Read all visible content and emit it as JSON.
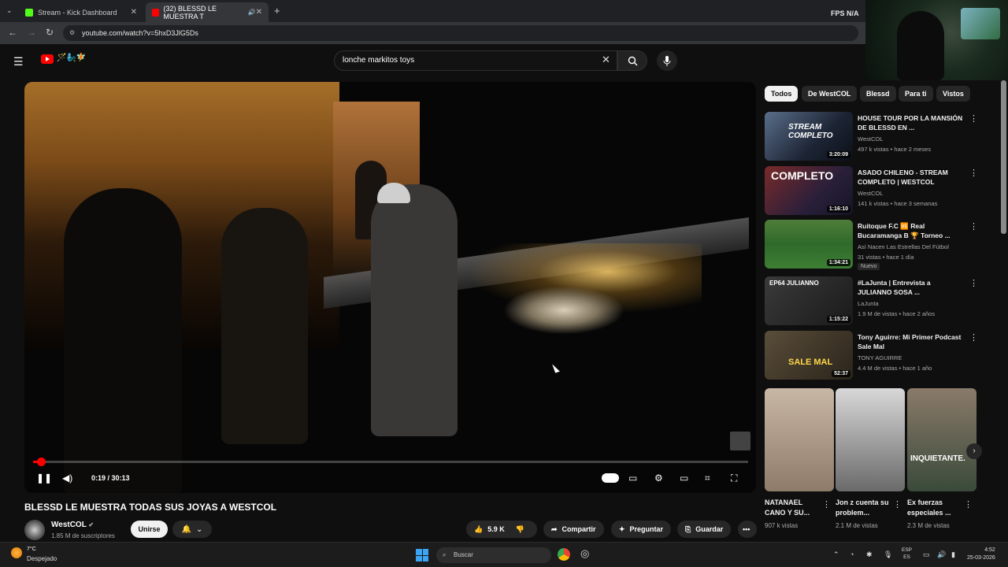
{
  "browser": {
    "tabs": [
      {
        "label": "Stream - Kick Dashboard",
        "active": false
      },
      {
        "label": "(32) BLESSD LE MUESTRA T",
        "active": true
      }
    ],
    "new_tab": "+",
    "url": "youtube.com/watch?v=5hxD3JlG5Ds",
    "fps_label": "FPS",
    "fps_value": "N/A"
  },
  "youtube": {
    "search_query": "lonche markitos toys",
    "logo_emoji": "🪄🧞‍♂️🧚"
  },
  "player": {
    "time": "0:19 / 30:13",
    "progress_fraction": 0.0105
  },
  "video": {
    "title": "BLESSD LE MUESTRA TODAS SUS JOYAS A WESTCOL",
    "channel": "WestCOL",
    "subscribers": "1.85 M de suscriptores",
    "join_label": "Unirse",
    "likes": "5.9 K",
    "share_label": "Compartir",
    "ask_label": "Preguntar",
    "save_label": "Guardar"
  },
  "chips": [
    "Todos",
    "De WestCOL",
    "Blessd",
    "Para ti",
    "Vistos"
  ],
  "recommendations": [
    {
      "title": "HOUSE TOUR POR LA MANSIÓN DE BLESSD EN ...",
      "channel": "WestCOL",
      "meta": "497 k vistas • hace 2 meses",
      "duration": "3:20:09"
    },
    {
      "title": "ASADO CHILENO - STREAM COMPLETO | WESTCOL",
      "channel": "WestCOL",
      "meta": "141 k vistas • hace 3 semanas",
      "duration": "1:16:10"
    },
    {
      "title": "Ruitoque F.C 🆚 Real Bucaramanga B 🏆 Torneo ...",
      "channel": "Así Nacen Las Estrellas Del Fútbol",
      "meta": "31 vistas • hace 1 día",
      "duration": "1:34:21",
      "badge": "Nuevo"
    },
    {
      "title": "#LaJunta | Entrevista a JULIANNO SOSA ...",
      "channel": "LaJunta",
      "meta": "1.9 M de vistas • hace 2 años",
      "duration": "1:15:22"
    },
    {
      "title": "Tony Aguirre: Mi Primer Podcast Sale Mal",
      "channel": "TONY AGUIRRE",
      "meta": "4.4 M de vistas • hace 1 año",
      "duration": "52:37"
    }
  ],
  "shorts": [
    {
      "title": "NATANAEL CANO Y SU...",
      "views": "907 k vistas"
    },
    {
      "title": "Jon z cuenta su problem...",
      "views": "2.1 M de vistas"
    },
    {
      "title": "Ex fuerzas especiales ...",
      "views": "2.3 M de vistas"
    }
  ],
  "shorts_overlay_text": "INQUIETANTE.",
  "thumb_overlays": [
    "STREAM COMPLETO",
    "COMPLETO",
    "EP64 JULIANNO",
    "SALE MAL"
  ],
  "taskbar": {
    "temp": "7°C",
    "condition": "Despejado",
    "search": "Buscar",
    "lang_top": "ESP",
    "lang_bottom": "ES",
    "time": "4:52",
    "date": "25-03-2026"
  },
  "colors": {
    "accent": "#ff0000",
    "background": "#0f0f0f"
  }
}
